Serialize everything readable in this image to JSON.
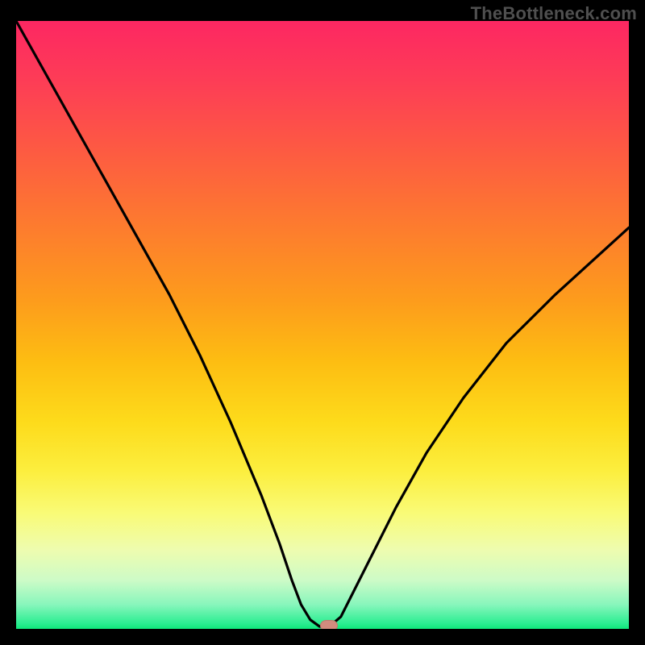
{
  "watermark": "TheBottleneck.com",
  "chart_data": {
    "type": "line",
    "title": "",
    "xlabel": "",
    "ylabel": "",
    "xlim": [
      0,
      100
    ],
    "ylim": [
      0,
      100
    ],
    "series": [
      {
        "name": "curve-left",
        "x": [
          0,
          5,
          10,
          15,
          20,
          25,
          30,
          35,
          40,
          43,
          45,
          46.5,
          48,
          49.5,
          51
        ],
        "values": [
          100,
          91,
          82,
          73,
          64,
          55,
          45,
          34,
          22,
          14,
          8,
          4,
          1.5,
          0.4,
          0.3
        ]
      },
      {
        "name": "curve-right",
        "x": [
          51,
          53,
          55,
          58,
          62,
          67,
          73,
          80,
          88,
          100
        ],
        "values": [
          0.3,
          2,
          6,
          12,
          20,
          29,
          38,
          47,
          55,
          66
        ]
      }
    ],
    "marker": {
      "x": 51,
      "y": 0.3,
      "label": ""
    },
    "background": "heat-gradient-vertical",
    "colors": {
      "curve": "#000000",
      "marker": "#d18b7e",
      "frame": "#000000"
    }
  }
}
